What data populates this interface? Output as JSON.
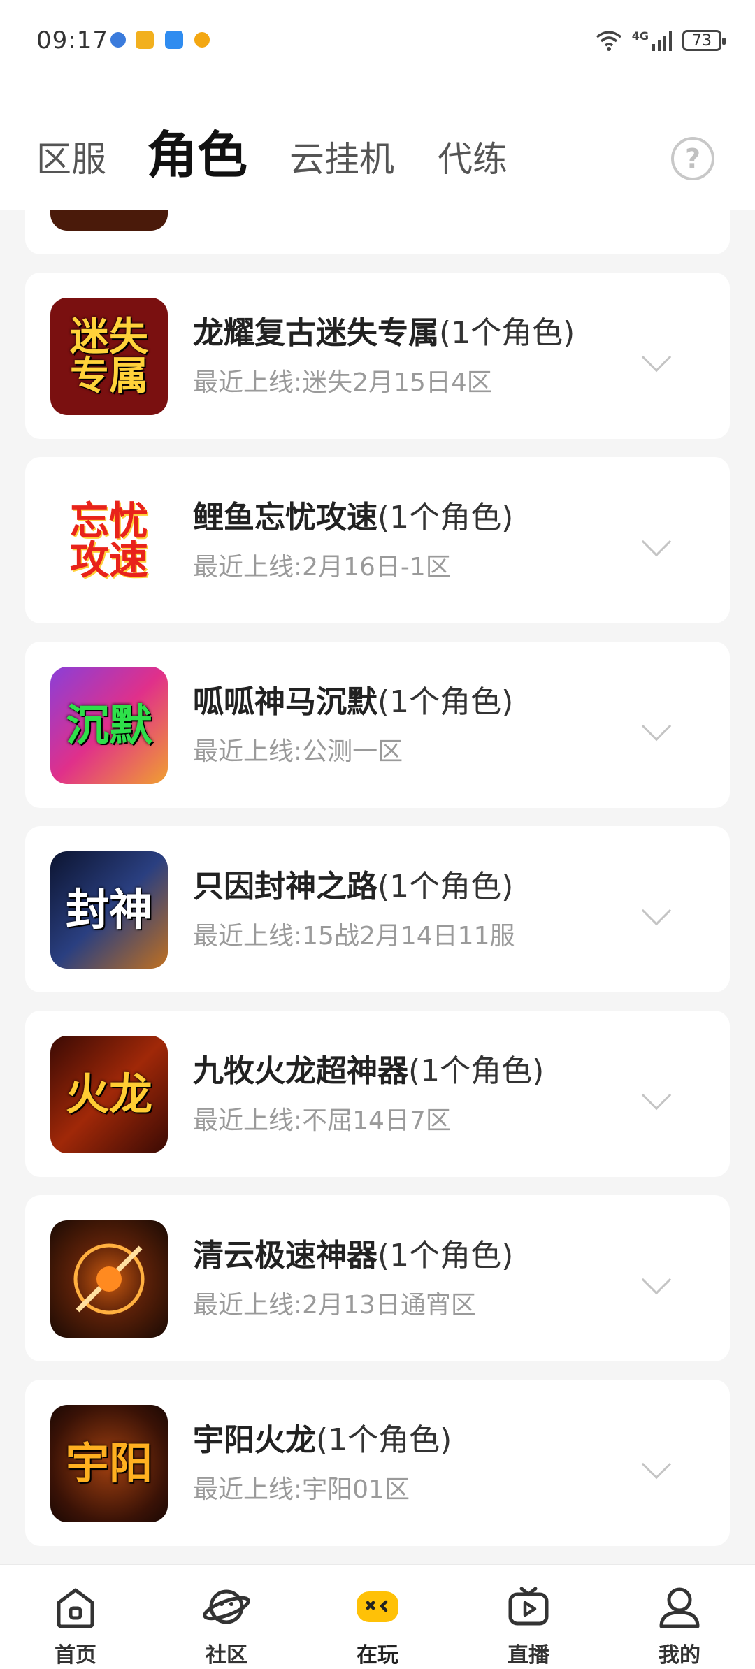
{
  "status_bar": {
    "time": "09:17",
    "network": "4G",
    "battery": "73",
    "app_icon_colors": [
      "#3a7bdc",
      "#f2b01e",
      "#2f8cf0",
      "#f3a712"
    ]
  },
  "header": {
    "tabs": [
      {
        "label": "区服",
        "active": false
      },
      {
        "label": "角色",
        "active": true
      },
      {
        "label": "云挂机",
        "active": false
      },
      {
        "label": "代练",
        "active": false
      }
    ],
    "help_label": "?"
  },
  "games": [
    {
      "name": "龙耀复古迷失专属",
      "count": "(1个角色)",
      "last_online_label": "最近上线:",
      "last_online": "迷失2月15日4区",
      "icon_text": "迷失专属",
      "icon_bg": "#7a1010",
      "icon_fg": "#ffd23a"
    },
    {
      "name": "鲤鱼忘忧攻速",
      "count": "(1个角色)",
      "last_online_label": "最近上线:",
      "last_online": "2月16日-1区",
      "icon_text": "忘忧攻速",
      "icon_bg": "#ffffff",
      "icon_fg": "#e8231b"
    },
    {
      "name": "呱呱神马沉默",
      "count": "(1个角色)",
      "last_online_label": "最近上线:",
      "last_online": "公测一区",
      "icon_text": "沉默",
      "icon_bg": "#8a3fd8",
      "icon_fg": "#2ee04a"
    },
    {
      "name": "只因封神之路",
      "count": "(1个角色)",
      "last_online_label": "最近上线:",
      "last_online": "15战2月14日11服",
      "icon_text": "封神",
      "icon_bg": "#1b2a5a",
      "icon_fg": "#ffffff"
    },
    {
      "name": "九牧火龙超神器",
      "count": "(1个角色)",
      "last_online_label": "最近上线:",
      "last_online": "不屈14日7区",
      "icon_text": "火龙",
      "icon_bg": "#5a1a08",
      "icon_fg": "#ffcc33"
    },
    {
      "name": "清云极速神器",
      "count": "(1个角色)",
      "last_online_label": "最近上线:",
      "last_online": "2月13日通宵区",
      "icon_text": "",
      "icon_bg": "#3a1a0a",
      "icon_fg": "#ff9a2a"
    },
    {
      "name": "宇阳火龙",
      "count": "(1个角色)",
      "last_online_label": "最近上线:",
      "last_online": "宇阳01区",
      "icon_text": "宇阳",
      "icon_bg": "#4a1808",
      "icon_fg": "#ffb020"
    }
  ],
  "bottom_nav": [
    {
      "label": "首页",
      "icon": "home-icon",
      "active": false
    },
    {
      "label": "社区",
      "icon": "planet-icon",
      "active": false
    },
    {
      "label": "在玩",
      "icon": "gamepad-icon",
      "active": true
    },
    {
      "label": "直播",
      "icon": "tv-icon",
      "active": false
    },
    {
      "label": "我的",
      "icon": "profile-icon",
      "active": false
    }
  ],
  "colors": {
    "accent": "#ffc107",
    "subtext": "#9a9a9a"
  }
}
